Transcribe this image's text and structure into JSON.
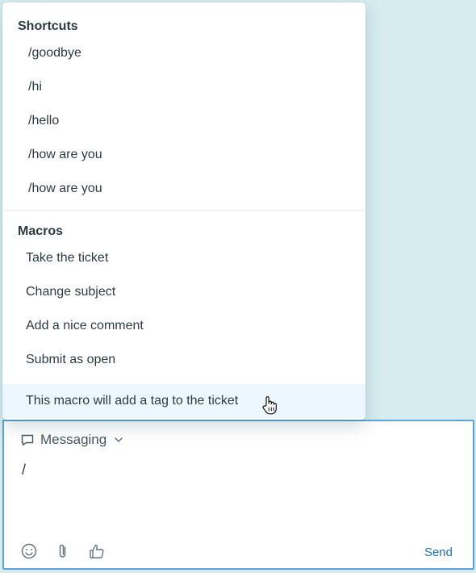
{
  "colors": {
    "background": "#d6ecee",
    "accent": "#1f73b7",
    "hover": "#edf7ff",
    "border_focus": "#5ba3d8"
  },
  "shortcuts": {
    "title": "Shortcuts",
    "items": [
      {
        "label": "/goodbye"
      },
      {
        "label": "/hi"
      },
      {
        "label": "/hello"
      },
      {
        "label": "/how are you"
      },
      {
        "label": "/how are you"
      }
    ]
  },
  "macros": {
    "title": "Macros",
    "items": [
      {
        "label": "Take the ticket"
      },
      {
        "label": "Change subject"
      },
      {
        "label": "Add a nice comment"
      },
      {
        "label": "Submit as open"
      },
      {
        "label": "This macro will add a tag to the ticket",
        "hovered": true
      }
    ]
  },
  "composer": {
    "channel_label": "Messaging",
    "channel_icon": "speech-bubble-icon",
    "text": "/",
    "send_label": "Send",
    "toolbar_icons": [
      "emoji-icon",
      "paperclip-icon",
      "thumbs-up-icon"
    ]
  }
}
